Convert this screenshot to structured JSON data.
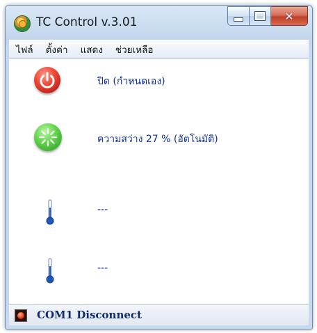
{
  "window": {
    "title": "TC  Control v.3.01"
  },
  "menu": {
    "items": [
      "ไฟล์",
      "ตั้งค่า",
      "แสดง",
      "ช่วยเหลือ"
    ]
  },
  "rows": {
    "power": {
      "label": "ปิด (กำหนดเอง)",
      "icon": "power-off-icon"
    },
    "light": {
      "label": "ความสว่าง 27 %  (อัตโนมัติ)",
      "icon": "light-sensor-icon"
    },
    "temp1": {
      "value": "---",
      "icon": "thermometer-icon"
    },
    "temp2": {
      "value": "---",
      "icon": "thermometer-icon"
    }
  },
  "status": {
    "text": "COM1  Disconnect",
    "led_color": "#e03a10"
  },
  "colors": {
    "label_text": "#10309a",
    "status_text": "#102a70"
  }
}
